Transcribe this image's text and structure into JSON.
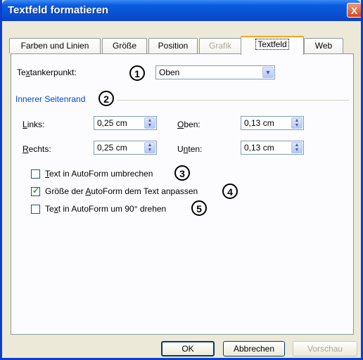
{
  "window": {
    "title": "Textfeld formatieren",
    "close_glyph": "X"
  },
  "tabs": [
    {
      "label": "Farben und Linien",
      "state": "normal"
    },
    {
      "label": "Größe",
      "state": "normal"
    },
    {
      "label": "Position",
      "state": "normal"
    },
    {
      "label": "Grafik",
      "state": "disabled"
    },
    {
      "label": "Textfeld",
      "state": "active"
    },
    {
      "label": "Web",
      "state": "normal"
    }
  ],
  "anchor": {
    "label_pre": "Te",
    "label_mnemonic": "x",
    "label_post": "tankerpunkt:",
    "value": "Oben",
    "callout": "1"
  },
  "margins": {
    "group_title": "Innerer Seitenrand",
    "callout": "2",
    "left": {
      "mnemonic": "L",
      "label": "inks:",
      "value": "0,25 cm"
    },
    "right": {
      "mnemonic": "R",
      "label": "echts:",
      "value": "0,25 cm"
    },
    "top": {
      "mnemonic": "O",
      "label": "ben:",
      "value": "0,13 cm"
    },
    "bottom": {
      "label_pre": "U",
      "mnemonic": "n",
      "label": "ten:",
      "value": "0,13 cm"
    }
  },
  "options": [
    {
      "pre": "",
      "mnemonic": "T",
      "post": "ext in AutoForm umbrechen",
      "checked": false,
      "callout": "3"
    },
    {
      "pre": "Größe der ",
      "mnemonic": "A",
      "post": "utoForm dem Text anpassen",
      "checked": true,
      "callout": "4"
    },
    {
      "pre": "Te",
      "mnemonic": "x",
      "post": "t in AutoForm um 90° drehen",
      "checked": false,
      "callout": "5"
    }
  ],
  "buttons": {
    "ok": "OK",
    "cancel": "Abbrechen",
    "preview": "Vorschau"
  },
  "colors": {
    "title_bar": "#0a4fd2",
    "group_title": "#0046d5",
    "active_tab_accent": "#f5a623",
    "check": "#21a121"
  },
  "icons": {
    "close": "close-icon",
    "dropdown": "chevron-down-icon",
    "spin": "spin-updown-icon",
    "check": "checkmark-icon"
  }
}
